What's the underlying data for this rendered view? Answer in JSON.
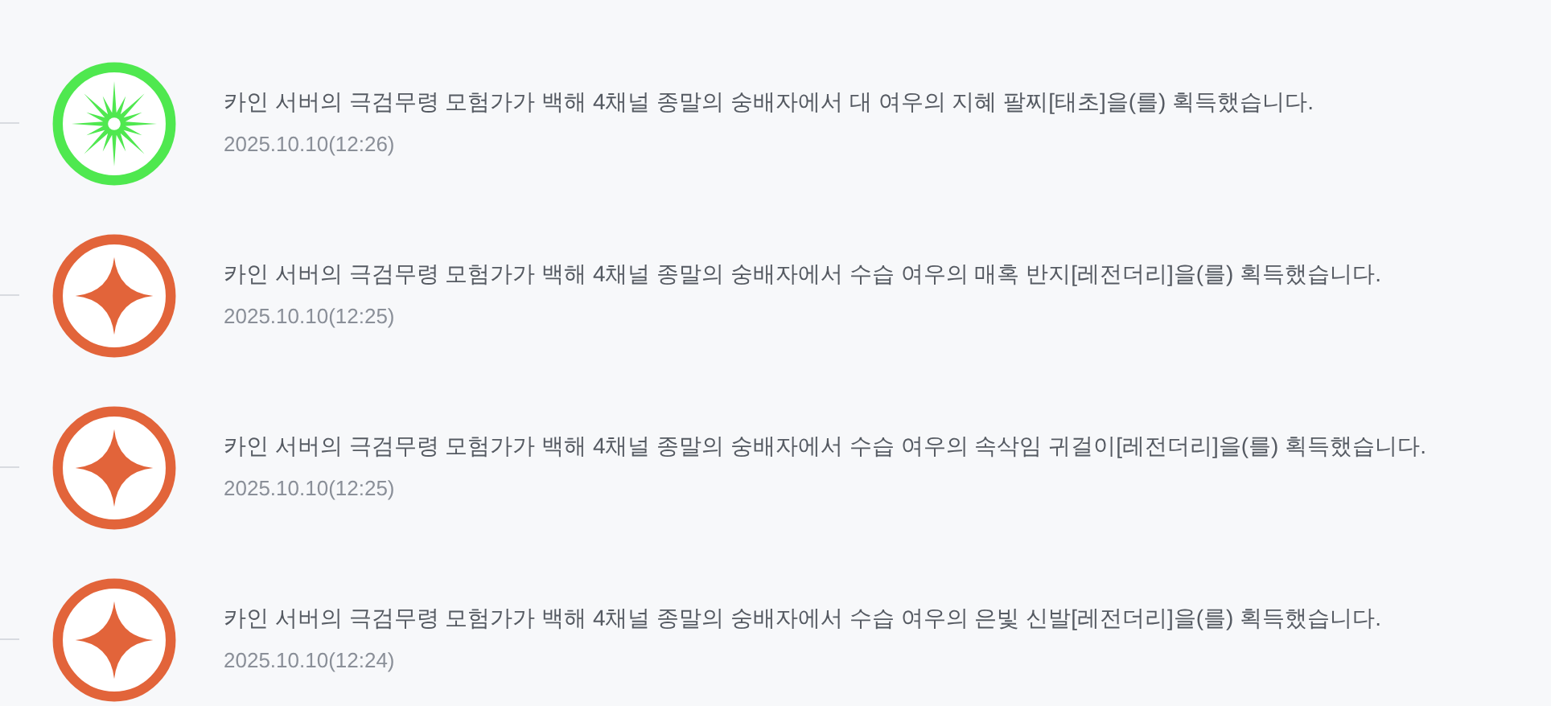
{
  "entries": [
    {
      "kind": "burst",
      "color": "#4fe84f",
      "message": "카인 서버의 극검무령 모험가가 백해 4채널 종말의 숭배자에서 대 여우의 지혜 팔찌[태초]을(를) 획득했습니다.",
      "time": "2025.10.10(12:26)"
    },
    {
      "kind": "star",
      "color": "#e2643a",
      "message": "카인 서버의 극검무령 모험가가 백해 4채널 종말의 숭배자에서 수습 여우의 매혹 반지[레전더리]을(를) 획득했습니다.",
      "time": "2025.10.10(12:25)"
    },
    {
      "kind": "star",
      "color": "#e2643a",
      "message": "카인 서버의 극검무령 모험가가 백해 4채널 종말의 숭배자에서 수습 여우의 속삭임 귀걸이[레전더리]을(를) 획득했습니다.",
      "time": "2025.10.10(12:25)"
    },
    {
      "kind": "star",
      "color": "#e2643a",
      "message": "카인 서버의 극검무령 모험가가 백해 4채널 종말의 숭배자에서 수습 여우의 은빛 신발[레전더리]을(를) 획득했습니다.",
      "time": "2025.10.10(12:24)"
    }
  ]
}
